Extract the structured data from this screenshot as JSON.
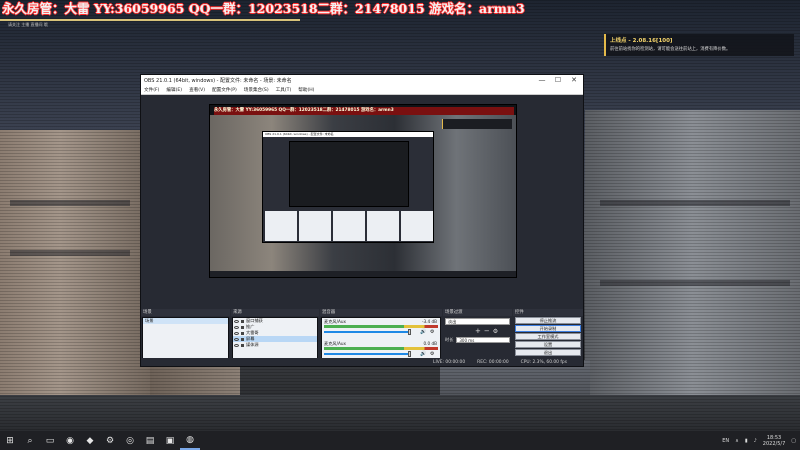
{
  "stream_overlay": {
    "banner": "永久房管：大雷 YY:36059965 QQ一群：12023518二群：21478015 游戏名：armn3",
    "sub": "请关注 主播 直播间 哦"
  },
  "game_notification": {
    "title": "上线点 - 2.08.16[100]",
    "body": "前往前站找你的检测站，请可能会送往前站上，消费有降价数。"
  },
  "obs": {
    "window_title": "OBS 21.0.1 (64bit, windows) - 配置文件: 未命名 - 场景: 未命名",
    "window_controls": {
      "minimize": "—",
      "maximize": "☐",
      "close": "✕"
    },
    "menu": [
      "文件(F)",
      "编辑(E)",
      "查看(V)",
      "配置文件(P)",
      "场景集合(S)",
      "工具(T)",
      "帮助(H)"
    ],
    "preview": {
      "banner": "永久房管：大雷 YY:36059965 QQ一群：12023518二群：21478015 游戏名：armn3",
      "nested_title": "OBS 21.0.1 (64bit, windows) - 配置文件: 未命名"
    },
    "docks": {
      "scenes": {
        "title": "场景",
        "items": [
          "场景"
        ],
        "foot": [
          "+",
          "−",
          "∧",
          "∨"
        ]
      },
      "sources": {
        "title": "来源",
        "items": [
          "窗口捕获",
          "推广",
          "大雷哥",
          "屏幕",
          "媒体源"
        ],
        "selected_index": 3,
        "foot": [
          "+",
          "−",
          "⚙",
          "∧",
          "∨"
        ]
      },
      "mixer": {
        "title": "混音器",
        "channels": [
          {
            "name": "麦克风/Aux",
            "db": "-3.4 dB"
          },
          {
            "name": "麦克风/Aux",
            "db": "0.0 dB"
          }
        ]
      },
      "transitions": {
        "title": "场景过渡",
        "selected": "淡出",
        "duration_label": "时长",
        "duration_value": "300 ms"
      },
      "controls": {
        "title": "控件",
        "buttons": [
          "停止推流",
          "开始录制",
          "工作室模式",
          "设置",
          "退出"
        ]
      }
    },
    "status": {
      "live": "LIVE: 00:00:00",
      "rec": "REC: 00:00:00",
      "cpu": "CPU: 2.3%, 60.00 fps"
    }
  },
  "taskbar": {
    "icons": [
      "windows-logo",
      "search",
      "task-view",
      "chrome",
      "android",
      "steam",
      "steam",
      "terminal",
      "monitor",
      "obs"
    ],
    "tray": {
      "lang": "EN",
      "time": "18:53",
      "date": "2022/5/7"
    }
  }
}
